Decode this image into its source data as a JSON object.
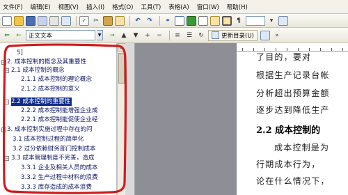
{
  "menu": {
    "items": [
      "文件(F)",
      "编辑(E)",
      "视图(V)",
      "插入(I)",
      "格式(O)",
      "工具(T)",
      "表格(A)",
      "窗口(W)",
      "帮助(H)"
    ]
  },
  "toolbar": {
    "style_value": "正文文本",
    "update_toc_label": "更新目录(U)"
  },
  "outline": {
    "items": [
      {
        "text": "5]"
      },
      {
        "text": "2. 成本控制的概念及其重要性"
      },
      {
        "text": "2.1 成本控制的概念"
      },
      {
        "text": "2.1.1 成本控制的理论概念"
      },
      {
        "text": "2.1.2 成本控制的意义"
      },
      {
        "text": "2.2 成本控制的重要性"
      },
      {
        "text": "2.2.2 成本控制能增强企业成"
      },
      {
        "text": "2.2.1 成本控制能促使企业经"
      },
      {
        "text": "3. 成本控制实施过程中存在的问"
      },
      {
        "text": "3.1 成本控制过程的简单化"
      },
      {
        "text": "3.2 过分依赖财务部门控制成本"
      },
      {
        "text": "3.3 成本管理制度不完善，造成"
      },
      {
        "text": "3.3.1 企业及相关人员的成本"
      },
      {
        "text": "3.3.2 生产过程中材料的浪费"
      },
      {
        "text": "3.3.3 库存造成的成本浪费"
      }
    ]
  },
  "document": {
    "lines": [
      "了目的，要对",
      "根据生产记录台帐",
      "分析超出预算金额",
      "逐步达到降低生产",
      "成本控制是为",
      "行期成本行为，",
      "论在什么情况下，"
    ],
    "heading": "2.2 成本控制的"
  },
  "colors": {
    "selection": "#0f2a8a",
    "annotation": "#d21a1a",
    "workspace": "#8e8e96"
  }
}
